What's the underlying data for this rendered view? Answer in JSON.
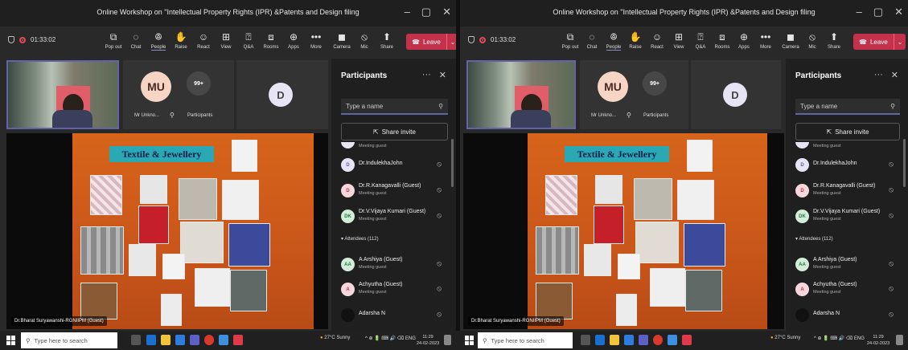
{
  "window": {
    "title": "Online Workshop on \"Intellectual Property Rights (IPR) &Patents and Design filing",
    "controls": [
      "–",
      "▢",
      "✕"
    ]
  },
  "toolbar": {
    "timer": "01:33:02",
    "buttons": [
      {
        "label": "Pop out",
        "icon": "popout-icon",
        "glyph": "⧉"
      },
      {
        "label": "Chat",
        "icon": "chat-icon",
        "glyph": "💬"
      },
      {
        "label": "People",
        "icon": "people-icon",
        "glyph": "👥"
      },
      {
        "label": "Raise",
        "icon": "raise-hand-icon",
        "glyph": "✋"
      },
      {
        "label": "React",
        "icon": "react-icon",
        "glyph": "☺"
      },
      {
        "label": "View",
        "icon": "view-icon",
        "glyph": "⊞"
      },
      {
        "label": "Q&A",
        "icon": "qa-icon",
        "glyph": "⍰"
      },
      {
        "label": "Rooms",
        "icon": "rooms-icon",
        "glyph": "⧈"
      },
      {
        "label": "Apps",
        "icon": "apps-icon",
        "glyph": "⊕"
      },
      {
        "label": "More",
        "icon": "more-icon",
        "glyph": "•••"
      },
      {
        "label": "Camera",
        "icon": "camera-off-icon",
        "glyph": "◼"
      },
      {
        "label": "Mic",
        "icon": "mic-off-icon",
        "glyph": "🎙"
      },
      {
        "label": "Share",
        "icon": "share-icon",
        "glyph": "⬆"
      }
    ],
    "leave_label": "Leave",
    "leave_color": "#c4314b"
  },
  "stage": {
    "tile1": {
      "initials": "MU",
      "name": "Mr Unkno...",
      "pin_glyph": "⚲"
    },
    "tile2": {
      "count": "99+",
      "label": "Participants"
    },
    "tile3": {
      "initials": "D"
    },
    "slide_title": "Textile & Jewellery",
    "presenter": "Dr.Bharat Suryawanshi-RGNIIPM (Guest)"
  },
  "panel": {
    "title": "Participants",
    "more": "···",
    "close": "✕",
    "search_placeholder": "Type a name",
    "share_invite": "Share invite",
    "partial_row_sub": "Meeting guest",
    "rows": [
      {
        "initials": "D",
        "name": "Dr.IndulekhaJohn",
        "sub": "",
        "color": "#e7e4f5",
        "textcolor": "#5b5fc7"
      },
      {
        "initials": "D",
        "name": "Dr.R.Kanagavalli (Guest)",
        "sub": "Meeting guest",
        "color": "#f8d7dc",
        "textcolor": "#c4314b"
      },
      {
        "initials": "DK",
        "name": "Dr.V.Vijaya Kumari (Guest)",
        "sub": "Meeting guest",
        "color": "#d4edd8",
        "textcolor": "#237b4b"
      }
    ],
    "attendees_label": "Attendees (112)",
    "attendees": [
      {
        "initials": "AA",
        "name": "A Arshiya (Guest)",
        "sub": "Meeting guest",
        "color": "#d4edd8",
        "textcolor": "#237b4b"
      },
      {
        "initials": "A",
        "name": "Achyutha (Guest)",
        "sub": "Meeting guest",
        "color": "#f8d7dc",
        "textcolor": "#c4314b"
      },
      {
        "initials": "",
        "name": "Adarsha N",
        "sub": "",
        "color": "#111111",
        "textcolor": "#111111"
      }
    ]
  },
  "taskbar": {
    "search_placeholder": "Type here to search",
    "weather": "27°C  Sunny",
    "tray": "^  ⊕  🔋  ⌨  🔊  ⌫  ENG",
    "time": "11:29",
    "date": "24-02-2023"
  }
}
